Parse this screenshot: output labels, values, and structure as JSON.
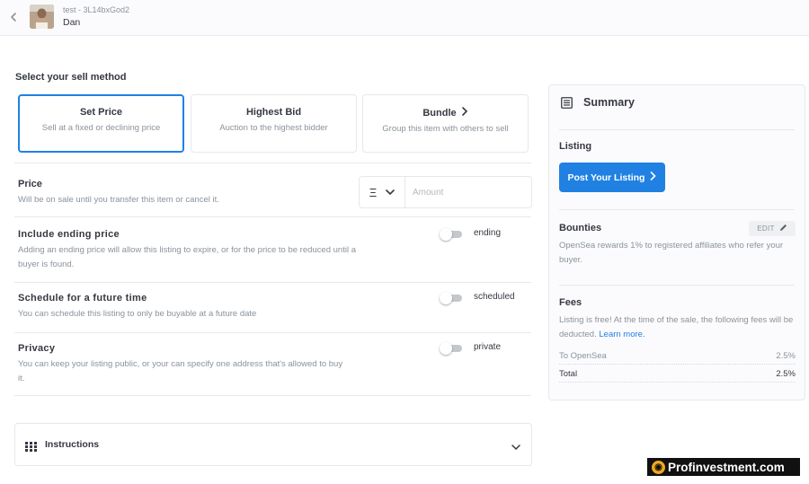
{
  "header": {
    "collection": "test - 3L14bxGod2",
    "item_name": "Dan"
  },
  "sell_method": {
    "title": "Select your sell method",
    "options": [
      {
        "title": "Set Price",
        "subtitle": "Sell at a fixed or declining price",
        "active": true
      },
      {
        "title": "Highest Bid",
        "subtitle": "Auction to the highest bidder",
        "active": false
      },
      {
        "title": "Bundle",
        "subtitle": "Group this item with others to sell",
        "active": false
      }
    ]
  },
  "price": {
    "title": "Price",
    "description": "Will be on sale until you transfer this item or cancel it.",
    "currency_symbol": "Ξ",
    "amount_value": "",
    "amount_placeholder": "Amount"
  },
  "options": [
    {
      "title": "Include ending price",
      "description": "Adding an ending price will allow this listing to expire, or for the price to be reduced until a buyer is found.",
      "toggle_label": "ending",
      "on": false
    },
    {
      "title": "Schedule for a future time",
      "description": "You can schedule this listing to only be buyable at a future date",
      "toggle_label": "scheduled",
      "on": false
    },
    {
      "title": "Privacy",
      "description": "You can keep your listing public, or your can specify one address that's allowed to buy it.",
      "toggle_label": "private",
      "on": false
    }
  ],
  "instructions": {
    "label": "Instructions"
  },
  "summary": {
    "title": "Summary",
    "listing": {
      "heading": "Listing",
      "button_label": "Post Your Listing"
    },
    "bounties": {
      "heading": "Bounties",
      "edit_label": "EDIT",
      "text": "OpenSea rewards 1% to registered affiliates who refer your buyer."
    },
    "fees": {
      "heading": "Fees",
      "text": "Listing is free! At the time of the sale, the following fees will be deducted.",
      "link": "Learn more.",
      "rows": [
        {
          "label": "To OpenSea",
          "value": "2.5%"
        },
        {
          "label": "Total",
          "value": "2.5%"
        }
      ]
    }
  },
  "watermark": {
    "text": "Profinvestment.com"
  },
  "colors": {
    "accent": "#2081e2",
    "text": "#353840",
    "muted": "#8a939b",
    "border": "#e5e8eb"
  }
}
